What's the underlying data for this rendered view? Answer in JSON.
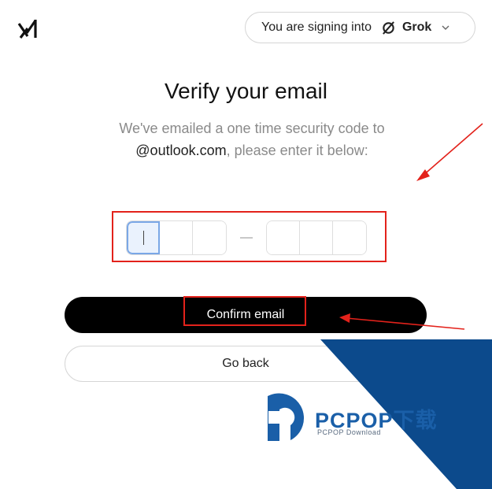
{
  "header": {
    "logo_icon": "x-ai-logo-icon",
    "signing_prefix": "You are signing into",
    "app_name": "Grok",
    "app_icon": "grok-logo-icon",
    "dropdown_icon": "chevron-down-icon"
  },
  "main": {
    "title": "Verify your email",
    "description_prefix": "We've emailed a one time security code to",
    "email_shown": "@outlook.com",
    "description_suffix": ", please enter it below:"
  },
  "code_input": {
    "group_1_cells": 3,
    "group_2_cells": 3,
    "separator": "—"
  },
  "actions": {
    "confirm_label": "Confirm email",
    "back_label": "Go back"
  },
  "watermark": {
    "title": "PCPOP下载",
    "subtitle": "PCPOP Download"
  },
  "colors": {
    "annotation": "#e3221b",
    "primary_button": "#000000",
    "active_cell_border": "#7aa7e6",
    "watermark_blue": "#0c4a8c"
  }
}
